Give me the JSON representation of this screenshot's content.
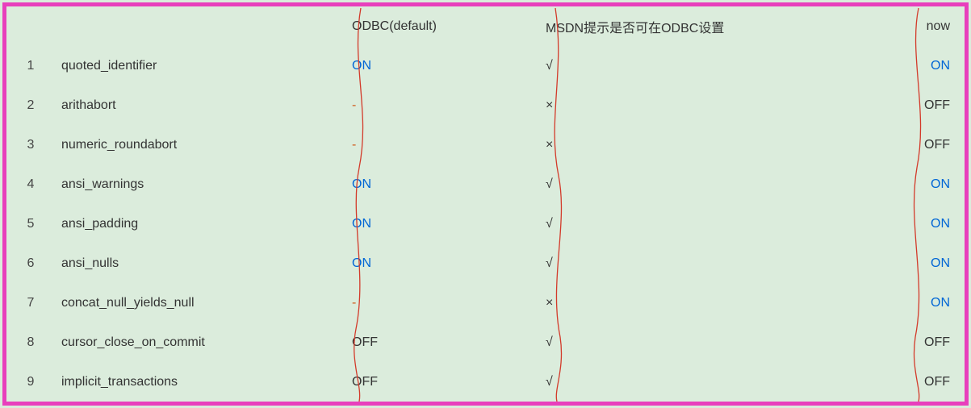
{
  "headers": {
    "odbc": "ODBC(default)",
    "msdn": "MSDN提示是否可在ODBC设置",
    "now": "now"
  },
  "rows": [
    {
      "n": "1",
      "name": "quoted_identifier",
      "odbc": "ON",
      "odbc_style": "on",
      "msdn": "√",
      "now": "ON",
      "now_style": "on"
    },
    {
      "n": "2",
      "name": "arithabort",
      "odbc": "-",
      "odbc_style": "dash",
      "msdn": "×",
      "now": "OFF",
      "now_style": "off"
    },
    {
      "n": "3",
      "name": "numeric_roundabort",
      "odbc": "-",
      "odbc_style": "dash",
      "msdn": "×",
      "now": "OFF",
      "now_style": "off"
    },
    {
      "n": "4",
      "name": "ansi_warnings",
      "odbc": "ON",
      "odbc_style": "on",
      "msdn": "√",
      "now": "ON",
      "now_style": "on"
    },
    {
      "n": "5",
      "name": "ansi_padding",
      "odbc": "ON",
      "odbc_style": "on",
      "msdn": "√",
      "now": "ON",
      "now_style": "on"
    },
    {
      "n": "6",
      "name": "ansi_nulls",
      "odbc": "ON",
      "odbc_style": "on",
      "msdn": "√",
      "now": "ON",
      "now_style": "on"
    },
    {
      "n": "7",
      "name": "concat_null_yields_null",
      "odbc": "-",
      "odbc_style": "dash",
      "msdn": "×",
      "now": "ON",
      "now_style": "on"
    },
    {
      "n": "8",
      "name": "cursor_close_on_commit",
      "odbc": "OFF",
      "odbc_style": "off",
      "msdn": "√",
      "now": "OFF",
      "now_style": "off"
    },
    {
      "n": "9",
      "name": "implicit_transactions",
      "odbc": "OFF",
      "odbc_style": "off",
      "msdn": "√",
      "now": "OFF",
      "now_style": "off"
    }
  ]
}
